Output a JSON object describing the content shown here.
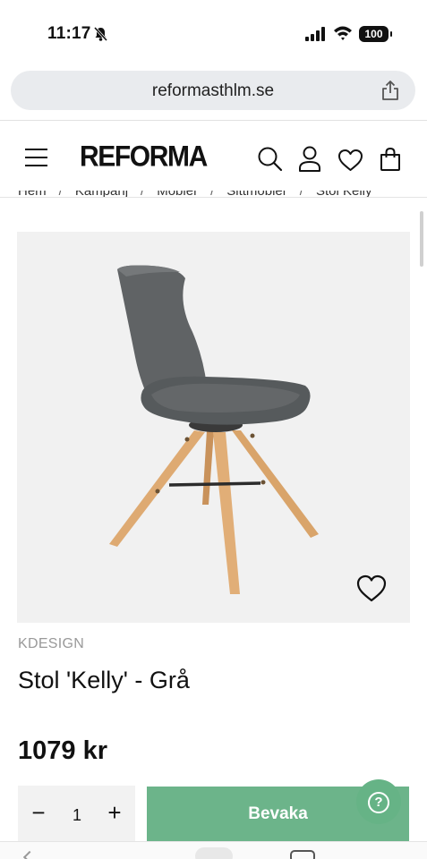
{
  "status_bar": {
    "time": "11:17",
    "battery": "100"
  },
  "browser": {
    "url": "reformasthlm.se"
  },
  "header": {
    "logo": "REFORMA"
  },
  "breadcrumb": [
    "Hem",
    "Kampanj",
    "Möbler",
    "Sittmöbler",
    "Stol Kelly"
  ],
  "product": {
    "brand": "KDESIGN",
    "title": "Stol 'Kelly' - Grå",
    "price": "1079 kr",
    "quantity": "1"
  },
  "actions": {
    "minus": "−",
    "plus": "+",
    "watch_label": "Bevaka",
    "help_label": "?"
  },
  "colors": {
    "accent_green": "#6cb48a",
    "chair_gray": "#5e6163",
    "wood": "#d9a46a"
  }
}
